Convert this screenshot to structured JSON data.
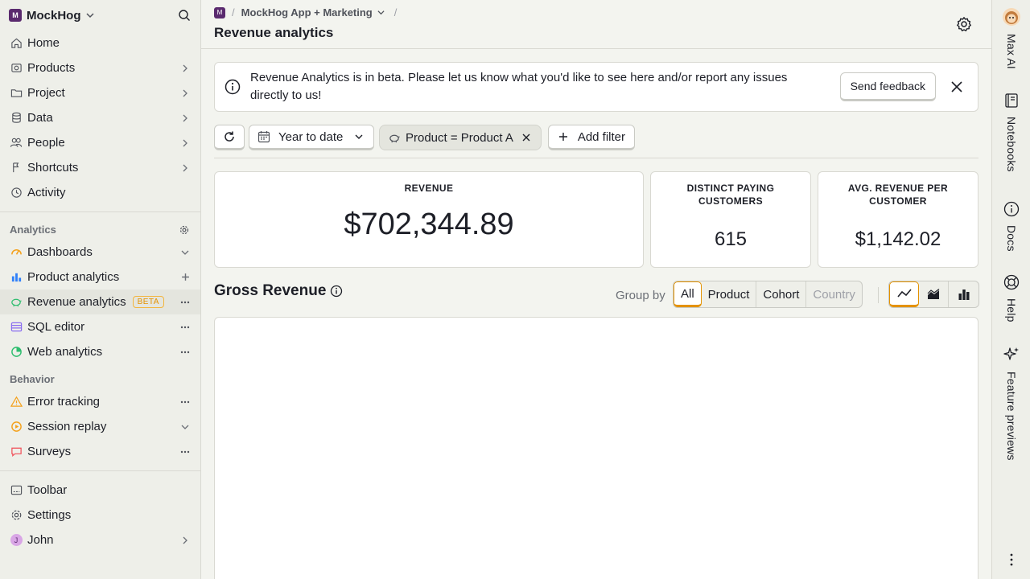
{
  "sidebar": {
    "org": {
      "initial": "M",
      "name": "MockHog"
    },
    "nav": [
      {
        "label": "Home",
        "icon": "home-icon"
      },
      {
        "label": "Products",
        "icon": "box-icon"
      },
      {
        "label": "Project",
        "icon": "folder-icon"
      },
      {
        "label": "Data",
        "icon": "database-icon"
      },
      {
        "label": "People",
        "icon": "people-icon"
      },
      {
        "label": "Shortcuts",
        "icon": "shortcut-icon"
      },
      {
        "label": "Activity",
        "icon": "clock-icon"
      }
    ],
    "analytics_title": "Analytics",
    "analytics": [
      {
        "label": "Dashboards"
      },
      {
        "label": "Product analytics"
      },
      {
        "label": "Revenue analytics",
        "badge": "BETA"
      },
      {
        "label": "SQL editor"
      },
      {
        "label": "Web analytics"
      }
    ],
    "behavior_title": "Behavior",
    "behavior": [
      {
        "label": "Error tracking"
      },
      {
        "label": "Session replay"
      },
      {
        "label": "Surveys"
      }
    ],
    "bottom": [
      {
        "label": "Toolbar"
      },
      {
        "label": "Settings"
      },
      {
        "label": "John",
        "initial": "J"
      }
    ]
  },
  "header": {
    "breadcrumb_logo": "M",
    "project": "MockHog App + Marketing",
    "title": "Revenue analytics"
  },
  "banner": {
    "text": "Revenue Analytics is in beta. Please let us know what you'd like to see here and/or report any issues directly to us!",
    "button": "Send feedback"
  },
  "filters": {
    "date_range": "Year to date",
    "chip": "Product = Product A",
    "add_filter": "Add filter"
  },
  "stats": [
    {
      "label": "REVENUE",
      "value": "$702,344.89"
    },
    {
      "label": "DISTINCT PAYING CUSTOMERS",
      "value": "615"
    },
    {
      "label": "AVG. REVENUE PER CUSTOMER",
      "value": "$1,142.02"
    }
  ],
  "gross": {
    "title": "Gross Revenue",
    "group_by_label": "Group by",
    "group_options": [
      "All",
      "Product",
      "Cohort",
      "Country"
    ],
    "selected_group": "All",
    "chart_types": [
      "line-chart-icon",
      "area-chart-icon",
      "bar-chart-icon"
    ],
    "selected_chart_type": "line-chart-icon"
  },
  "rail": [
    {
      "label": "Max AI"
    },
    {
      "label": "Notebooks"
    },
    {
      "label": "Docs"
    },
    {
      "label": "Help"
    },
    {
      "label": "Feature previews"
    }
  ],
  "colors": {
    "accent": "#e49200",
    "brand": "#5a2a6e"
  }
}
